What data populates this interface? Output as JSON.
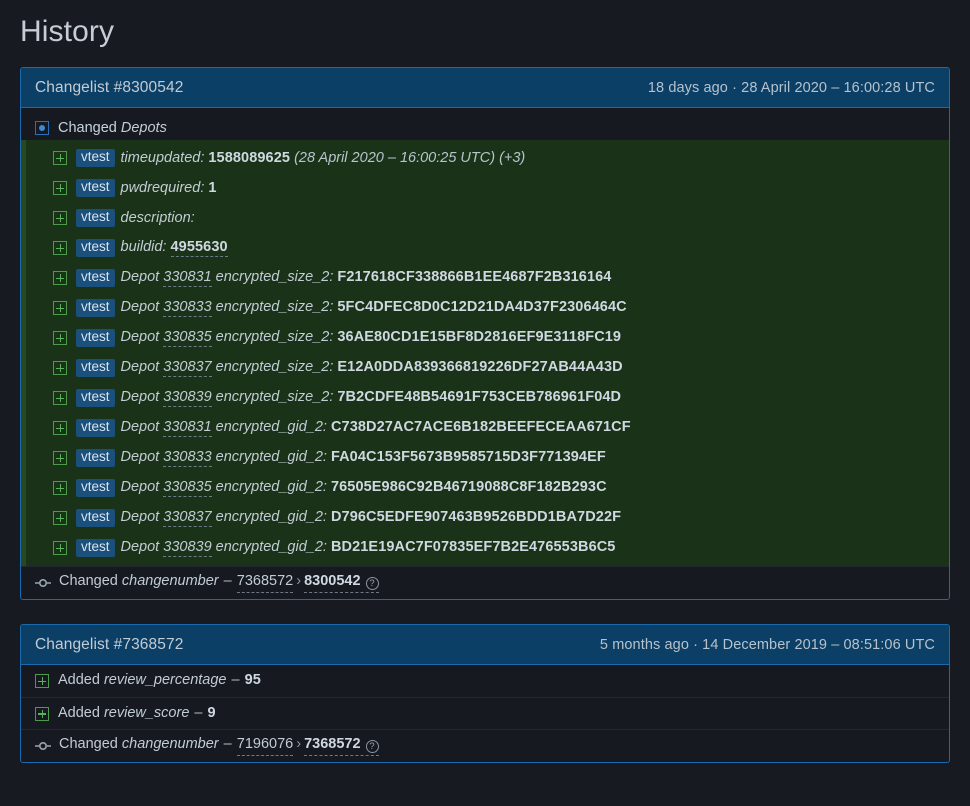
{
  "page": {
    "title": "History",
    "colors": {
      "page_bg": "#171a21",
      "card_border": "#1a6aad",
      "header_bg": "#0b3f66",
      "depot_bg": "#1a3318",
      "added_icon": "#59b159",
      "changed_icon": "#3a8ad6",
      "badge_bg": "#1b4f7c"
    }
  },
  "changelists": [
    {
      "title": "Changelist #8300542",
      "date": "18 days ago · 28 April 2020 – 16:00:28 UTC",
      "changed_section": {
        "icon": "changed-square-icon",
        "verb": "Changed",
        "field": "Depots"
      },
      "depot_rows": [
        {
          "icon": "added-square-icon",
          "badge": "vtest",
          "key": "timeupdated:",
          "value": "1588089625",
          "meta": "(28 April 2020 – 16:00:25 UTC) (+3)"
        },
        {
          "icon": "added-square-icon",
          "badge": "vtest",
          "key": "pwdrequired:",
          "value": "1",
          "meta": ""
        },
        {
          "icon": "added-square-icon",
          "badge": "vtest",
          "key": "description:",
          "value": "",
          "meta": ""
        },
        {
          "icon": "added-square-icon",
          "badge": "vtest",
          "key": "buildid:",
          "value": "4955630",
          "value_dashed": true,
          "meta": ""
        },
        {
          "icon": "added-square-icon",
          "badge": "vtest",
          "key_prefix": "Depot",
          "depot_id": "330831",
          "key": "encrypted_size_2:",
          "value": "F217618CF338866B1EE4687F2B316164",
          "meta": ""
        },
        {
          "icon": "added-square-icon",
          "badge": "vtest",
          "key_prefix": "Depot",
          "depot_id": "330833",
          "key": "encrypted_size_2:",
          "value": "5FC4DFEC8D0C12D21DA4D37F2306464C",
          "meta": ""
        },
        {
          "icon": "added-square-icon",
          "badge": "vtest",
          "key_prefix": "Depot",
          "depot_id": "330835",
          "key": "encrypted_size_2:",
          "value": "36AE80CD1E15BF8D2816EF9E3118FC19",
          "meta": ""
        },
        {
          "icon": "added-square-icon",
          "badge": "vtest",
          "key_prefix": "Depot",
          "depot_id": "330837",
          "key": "encrypted_size_2:",
          "value": "E12A0DDA839366819226DF27AB44A43D",
          "meta": ""
        },
        {
          "icon": "added-square-icon",
          "badge": "vtest",
          "key_prefix": "Depot",
          "depot_id": "330839",
          "key": "encrypted_size_2:",
          "value": "7B2CDFE48B54691F753CEB786961F04D",
          "meta": ""
        },
        {
          "icon": "added-square-icon",
          "badge": "vtest",
          "key_prefix": "Depot",
          "depot_id": "330831",
          "key": "encrypted_gid_2:",
          "value": "C738D27AC7ACE6B182BEEFECEAA671CF",
          "meta": ""
        },
        {
          "icon": "added-square-icon",
          "badge": "vtest",
          "key_prefix": "Depot",
          "depot_id": "330833",
          "key": "encrypted_gid_2:",
          "value": "FA04C153F5673B9585715D3F771394EF",
          "meta": ""
        },
        {
          "icon": "added-square-icon",
          "badge": "vtest",
          "key_prefix": "Depot",
          "depot_id": "330835",
          "key": "encrypted_gid_2:",
          "value": "76505E986C92B46719088C8F182B293C",
          "meta": ""
        },
        {
          "icon": "added-square-icon",
          "badge": "vtest",
          "key_prefix": "Depot",
          "depot_id": "330837",
          "key": "encrypted_gid_2:",
          "value": "D796C5EDFE907463B9526BDD1BA7D22F",
          "meta": ""
        },
        {
          "icon": "added-square-icon",
          "badge": "vtest",
          "key_prefix": "Depot",
          "depot_id": "330839",
          "key": "encrypted_gid_2:",
          "value": "BD21E19AC7F07835EF7B2E476553B6C5",
          "meta": ""
        }
      ],
      "footer_row": {
        "icon": "commit-node-icon",
        "verb": "Changed",
        "field": "changenumber",
        "dash": "–",
        "old_value": "7368572",
        "arrow": "›",
        "new_value": "8300542",
        "help_icon": "question-mark-circle-icon",
        "help_glyph": "?"
      }
    },
    {
      "title": "Changelist #7368572",
      "date": "5 months ago · 14 December 2019 – 08:51:06 UTC",
      "simple_rows": [
        {
          "icon": "added-square-icon",
          "verb": "Added",
          "field": "review_percentage",
          "dash": "–",
          "value": "95"
        },
        {
          "icon": "added-square-icon",
          "verb": "Added",
          "field": "review_score",
          "dash": "–",
          "value": "9"
        }
      ],
      "footer_row": {
        "icon": "commit-node-icon",
        "verb": "Changed",
        "field": "changenumber",
        "dash": "–",
        "old_value": "7196076",
        "arrow": "›",
        "new_value": "7368572",
        "help_icon": "question-mark-circle-icon",
        "help_glyph": "?"
      }
    }
  ]
}
